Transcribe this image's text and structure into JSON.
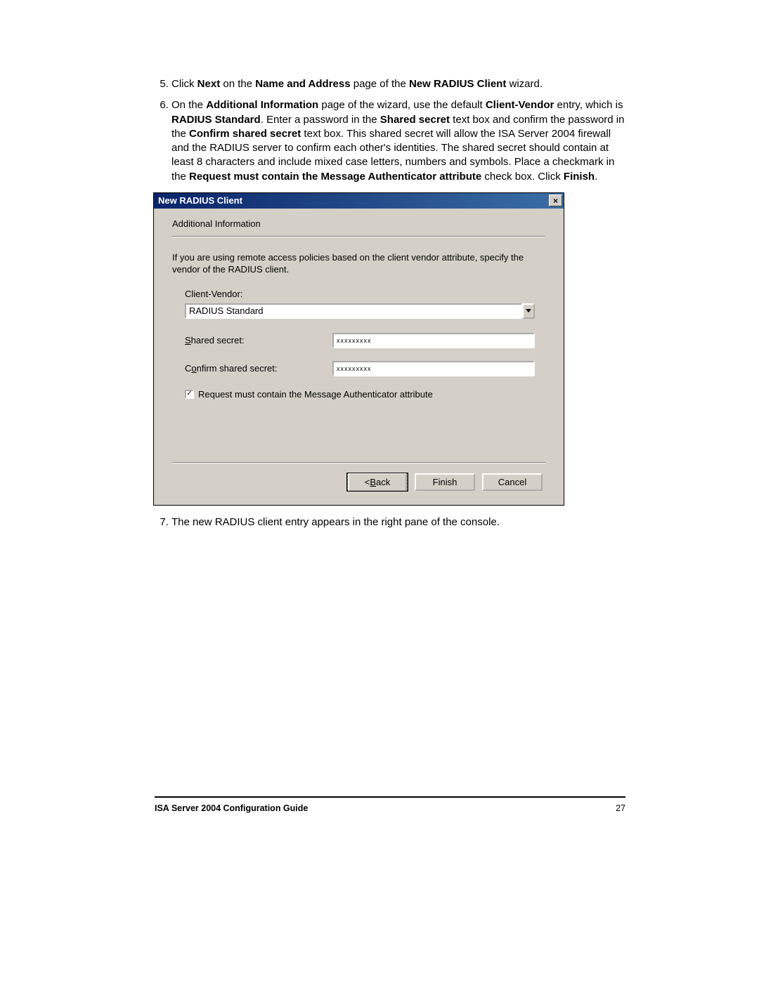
{
  "steps": {
    "s5": {
      "pre": "Click ",
      "bold1": "Next",
      "mid1": " on the ",
      "bold2": "Name and Address",
      "mid2": " page of the ",
      "bold3": "New RADIUS Client",
      "post": " wizard."
    },
    "s6": {
      "l1a": "On the ",
      "l1b": "Additional Information",
      "l1c": " page of the wizard, use the default ",
      "l1d": "Client-Vendor",
      "l1e": " entry, which is ",
      "l1f": "RADIUS Standard",
      "l1g": ". Enter a password in the ",
      "l1h": "Shared secret",
      "l1i": " text box and confirm the password in the ",
      "l1j": "Confirm shared secret",
      "l1k": " text box. This shared secret will allow the ISA Server 2004 firewall and the RADIUS server to confirm each other's identities. The shared secret should contain at least 8 characters and include mixed case letters, numbers and symbols. Place a checkmark in the ",
      "l1l": "Request must contain the Message Authenticator attribute",
      "l1m": " check box. Click ",
      "l1n": "Finish",
      "l1o": "."
    },
    "s7": "The new RADIUS client entry appears in the right pane of the console."
  },
  "dialog": {
    "title": "New RADIUS Client",
    "subtitle": "Additional Information",
    "description": "If you are using remote access policies based on the client vendor attribute, specify the vendor of the RADIUS client.",
    "clientVendorLabelPrefixU": "C",
    "clientVendorLabelRest": "lient-Vendor:",
    "clientVendorValue": "RADIUS Standard",
    "sharedSecretLabelPrefixU": "S",
    "sharedSecretLabelRest": "hared secret:",
    "sharedSecretValue": "xxxxxxxxx",
    "confirmLabelPre": "C",
    "confirmLabelU": "o",
    "confirmLabelRest": "nfirm shared secret:",
    "confirmValue": "xxxxxxxxx",
    "checkboxU": "R",
    "checkboxRest": "equest must contain the Message Authenticator attribute",
    "checkboxChecked": "✓",
    "backPre": "< ",
    "backU": "B",
    "backRest": "ack",
    "finish": "Finish",
    "cancel": "Cancel",
    "closeGlyph": "×"
  },
  "footer": {
    "left": "ISA Server 2004 Configuration Guide",
    "right": "27"
  }
}
